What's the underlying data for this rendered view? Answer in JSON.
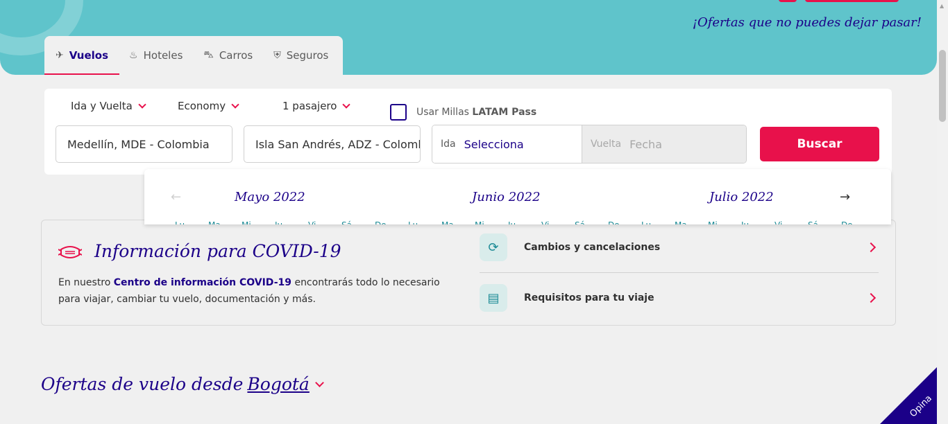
{
  "hero": {
    "tagline": "¡Ofertas que no puedes dejar pasar!"
  },
  "tabs": [
    {
      "label": "Vuelos",
      "icon": "plane-icon",
      "active": true
    },
    {
      "label": "Hoteles",
      "icon": "hotel-icon"
    },
    {
      "label": "Carros",
      "icon": "car-icon"
    },
    {
      "label": "Seguros",
      "icon": "shield-icon"
    }
  ],
  "search": {
    "trip_type": "Ida y Vuelta",
    "cabin": "Economy",
    "passengers": "1 pasajero",
    "miles_label": "Usar Millas",
    "miles_brand": "LATAM Pass",
    "origin": "Medellín, MDE - Colombia",
    "destination": "Isla San Andrés, ADZ - Colombia",
    "depart_label": "Ida",
    "depart_value": "Selecciona",
    "return_label": "Vuelta",
    "return_value": "Fecha",
    "search_button": "Buscar"
  },
  "calendar": {
    "months": [
      "Mayo 2022",
      "Junio 2022",
      "Julio 2022"
    ],
    "weekdays": [
      "Lu",
      "Ma",
      "Mi",
      "Ju",
      "Vi",
      "Sá",
      "Do"
    ]
  },
  "covid": {
    "title": "Información para COVID-19",
    "text_before": "En nuestro ",
    "link": "Centro de información COVID-19",
    "text_after": " encontrarás todo lo necesario para viajar, cambiar tu vuelo, documentación y más.",
    "items": [
      {
        "label": "Cambios y cancelaciones",
        "icon": "calendar-change-icon"
      },
      {
        "label": "Requisitos para tu viaje",
        "icon": "passport-icon"
      }
    ]
  },
  "offers": {
    "prefix": "Ofertas de vuelo desde",
    "city": "Bogotá"
  },
  "feedback": {
    "label": "Opina"
  },
  "colors": {
    "brand": "#1b0088",
    "accent": "#e8114b",
    "hero": "#5fc4cb"
  }
}
